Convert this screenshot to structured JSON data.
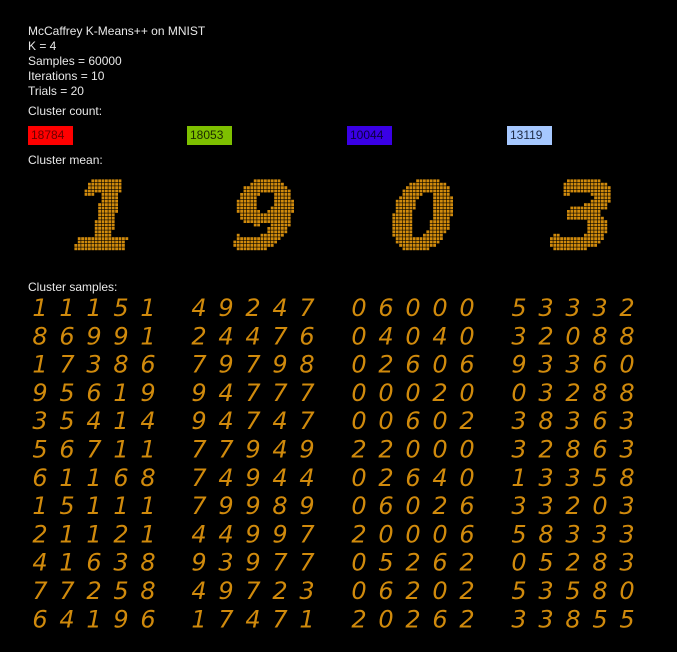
{
  "header": {
    "title": "McCaffrey K-Means++ on MNIST",
    "k": "K = 4",
    "samples": "Samples = 60000",
    "iterations": "Iterations = 10",
    "trials": "Trials = 20"
  },
  "labels": {
    "cluster_count": "Cluster count:",
    "cluster_mean": "Cluster mean:",
    "cluster_samples": "Cluster samples:"
  },
  "clusters": [
    {
      "count": "18784",
      "color": "#ff0000",
      "text_color": "#6a0000",
      "mean_digit": "1",
      "samples": [
        [
          "1",
          "1",
          "1",
          "5",
          "1"
        ],
        [
          "8",
          "6",
          "9",
          "9",
          "1"
        ],
        [
          "1",
          "7",
          "3",
          "8",
          "6"
        ],
        [
          "9",
          "5",
          "6",
          "1",
          "9"
        ],
        [
          "3",
          "5",
          "4",
          "1",
          "4"
        ],
        [
          "5",
          "6",
          "7",
          "1",
          "1"
        ],
        [
          "6",
          "1",
          "1",
          "6",
          "8"
        ],
        [
          "1",
          "5",
          "1",
          "1",
          "1"
        ],
        [
          "2",
          "1",
          "1",
          "2",
          "1"
        ],
        [
          "4",
          "1",
          "6",
          "3",
          "8"
        ],
        [
          "7",
          "7",
          "2",
          "5",
          "8"
        ],
        [
          "6",
          "4",
          "1",
          "9",
          "6"
        ]
      ]
    },
    {
      "count": "18053",
      "color": "#7ec000",
      "text_color": "#1c2a00",
      "mean_digit": "9",
      "samples": [
        [
          "4",
          "9",
          "2",
          "4",
          "7"
        ],
        [
          "2",
          "4",
          "4",
          "7",
          "6"
        ],
        [
          "7",
          "9",
          "7",
          "9",
          "8"
        ],
        [
          "9",
          "4",
          "7",
          "7",
          "7"
        ],
        [
          "9",
          "4",
          "7",
          "4",
          "7"
        ],
        [
          "7",
          "7",
          "9",
          "4",
          "9"
        ],
        [
          "7",
          "4",
          "9",
          "4",
          "4"
        ],
        [
          "7",
          "9",
          "9",
          "8",
          "9"
        ],
        [
          "4",
          "4",
          "9",
          "9",
          "7"
        ],
        [
          "9",
          "3",
          "9",
          "7",
          "7"
        ],
        [
          "4",
          "9",
          "7",
          "2",
          "3"
        ],
        [
          "1",
          "7",
          "4",
          "7",
          "1"
        ]
      ]
    },
    {
      "count": "10044",
      "color": "#3a00e6",
      "text_color": "#0c0040",
      "mean_digit": "0",
      "samples": [
        [
          "0",
          "6",
          "0",
          "0",
          "0"
        ],
        [
          "0",
          "4",
          "0",
          "4",
          "0"
        ],
        [
          "0",
          "2",
          "6",
          "0",
          "6"
        ],
        [
          "0",
          "0",
          "0",
          "2",
          "0"
        ],
        [
          "0",
          "0",
          "6",
          "0",
          "2"
        ],
        [
          "2",
          "2",
          "0",
          "0",
          "0"
        ],
        [
          "0",
          "2",
          "6",
          "4",
          "0"
        ],
        [
          "0",
          "6",
          "0",
          "2",
          "6"
        ],
        [
          "2",
          "0",
          "0",
          "0",
          "6"
        ],
        [
          "0",
          "5",
          "2",
          "6",
          "2"
        ],
        [
          "0",
          "6",
          "2",
          "0",
          "2"
        ],
        [
          "2",
          "0",
          "2",
          "6",
          "2"
        ]
      ]
    },
    {
      "count": "13119",
      "color": "#a6c8ff",
      "text_color": "#1e2a44",
      "mean_digit": "3",
      "samples": [
        [
          "5",
          "3",
          "3",
          "3",
          "2"
        ],
        [
          "3",
          "2",
          "0",
          "8",
          "8"
        ],
        [
          "9",
          "3",
          "3",
          "6",
          "0"
        ],
        [
          "0",
          "3",
          "2",
          "8",
          "8"
        ],
        [
          "3",
          "8",
          "3",
          "6",
          "3"
        ],
        [
          "3",
          "2",
          "8",
          "6",
          "3"
        ],
        [
          "1",
          "3",
          "3",
          "5",
          "8"
        ],
        [
          "3",
          "3",
          "2",
          "0",
          "3"
        ],
        [
          "5",
          "8",
          "3",
          "3",
          "3"
        ],
        [
          "0",
          "5",
          "2",
          "8",
          "3"
        ],
        [
          "5",
          "3",
          "5",
          "8",
          "0"
        ],
        [
          "3",
          "3",
          "8",
          "5",
          "5"
        ]
      ]
    }
  ],
  "colors": {
    "background": "#000000",
    "digit": "#d08a0c",
    "mean_grid": "#3a2600"
  }
}
